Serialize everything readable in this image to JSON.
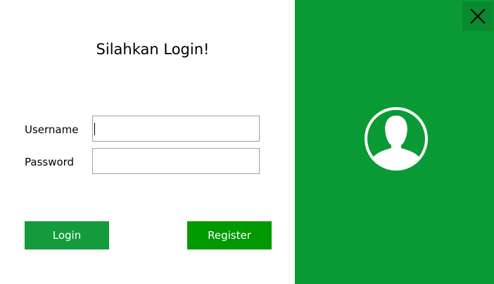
{
  "form": {
    "title": "Silahkan Login!",
    "username_label": "Username",
    "password_label": "Password",
    "username_value": "",
    "password_value": "",
    "login_label": "Login",
    "register_label": "Register"
  },
  "side_panel": {
    "avatar_icon": "user-avatar-icon",
    "close_icon": "close-icon",
    "background_color": "#0a9a35"
  },
  "colors": {
    "login_button": "#149b3c",
    "register_button": "#009a00"
  }
}
